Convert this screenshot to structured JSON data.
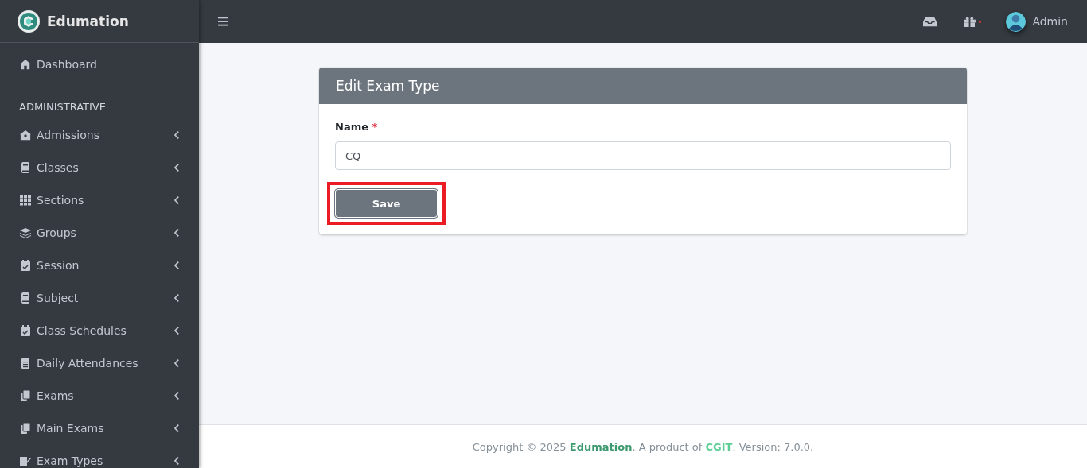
{
  "brand": {
    "name": "Edumation"
  },
  "topbar": {
    "notification_dot": true,
    "user": "Admin"
  },
  "sidebar": {
    "top_item": {
      "label": "Dashboard"
    },
    "section": "ADMINISTRATIVE",
    "items": [
      {
        "label": "Admissions",
        "expanded": false
      },
      {
        "label": "Classes",
        "expanded": false
      },
      {
        "label": "Sections",
        "expanded": false
      },
      {
        "label": "Groups",
        "expanded": false
      },
      {
        "label": "Session",
        "expanded": false
      },
      {
        "label": "Subject",
        "expanded": false
      },
      {
        "label": "Class Schedules",
        "expanded": false
      },
      {
        "label": "Daily Attendances",
        "expanded": false
      },
      {
        "label": "Exams",
        "expanded": false
      },
      {
        "label": "Main Exams",
        "expanded": false
      },
      {
        "label": "Exam Types",
        "expanded": false
      }
    ]
  },
  "card": {
    "title": "Edit Exam Type",
    "field": {
      "label": "Name",
      "required_mark": "*",
      "value": "CQ"
    },
    "button": {
      "label": "Save",
      "highlighted": true
    }
  },
  "footer": {
    "prefix": "Copyright © 2025 ",
    "brand": "Edumation",
    "middle": ". A product of ",
    "company": "CGIT",
    "suffix": ". Version: 7.0.0."
  }
}
